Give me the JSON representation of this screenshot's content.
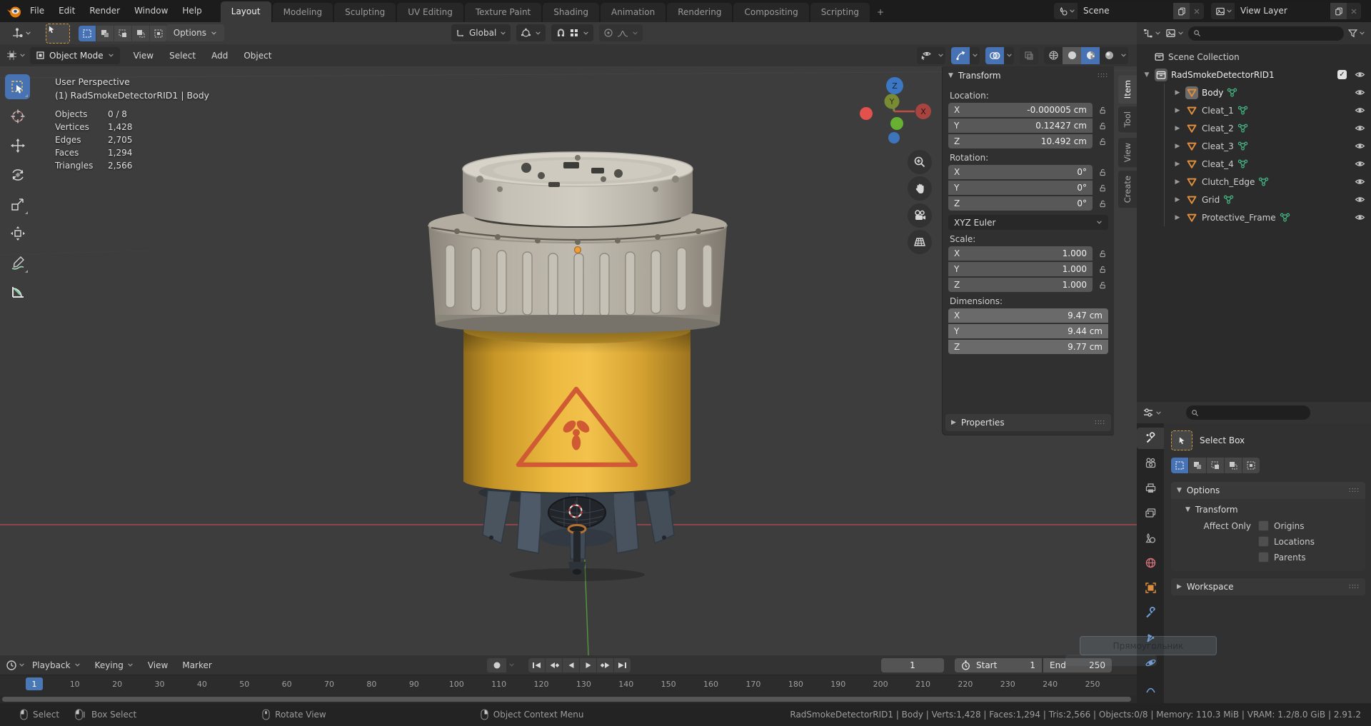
{
  "topbar": {
    "menus": [
      "File",
      "Edit",
      "Render",
      "Window",
      "Help"
    ],
    "tabs": [
      "Layout",
      "Modeling",
      "Sculpting",
      "UV Editing",
      "Texture Paint",
      "Shading",
      "Animation",
      "Rendering",
      "Compositing",
      "Scripting"
    ],
    "new_tab": "+",
    "scene": {
      "label": "Scene"
    },
    "view_layer": {
      "label": "View Layer"
    }
  },
  "tools": {
    "orientation": "Global",
    "options": "Options"
  },
  "viewport": {
    "mode": "Object Mode",
    "menus": [
      "View",
      "Select",
      "Add",
      "Object"
    ],
    "overlay": {
      "view": "User Perspective",
      "object": "(1) RadSmokeDetectorRID1 | Body",
      "stats": [
        {
          "label": "Objects",
          "value": "0 / 8"
        },
        {
          "label": "Vertices",
          "value": "1,428"
        },
        {
          "label": "Edges",
          "value": "2,705"
        },
        {
          "label": "Faces",
          "value": "1,294"
        },
        {
          "label": "Triangles",
          "value": "2,566"
        }
      ]
    },
    "axis_labels": {
      "x": "X",
      "y": "Y",
      "z": "Z"
    },
    "sidebar_tabs": [
      "Item",
      "Tool",
      "View",
      "Create"
    ]
  },
  "npanel": {
    "title": "Transform",
    "location_label": "Location:",
    "rows_loc": [
      {
        "axis": "X",
        "value": "-0.000005 cm"
      },
      {
        "axis": "Y",
        "value": "0.12427 cm"
      },
      {
        "axis": "Z",
        "value": "10.492 cm"
      }
    ],
    "rotation_label": "Rotation:",
    "rows_rot": [
      {
        "axis": "X",
        "value": "0°"
      },
      {
        "axis": "Y",
        "value": "0°"
      },
      {
        "axis": "Z",
        "value": "0°"
      }
    ],
    "euler": "XYZ Euler",
    "scale_label": "Scale:",
    "rows_scale": [
      {
        "axis": "X",
        "value": "1.000"
      },
      {
        "axis": "Y",
        "value": "1.000"
      },
      {
        "axis": "Z",
        "value": "1.000"
      }
    ],
    "dims_label": "Dimensions:",
    "rows_dims": [
      {
        "axis": "X",
        "value": "9.47 cm"
      },
      {
        "axis": "Y",
        "value": "9.44 cm"
      },
      {
        "axis": "Z",
        "value": "9.77 cm"
      }
    ],
    "properties": "Properties"
  },
  "outliner": {
    "root": "Scene Collection",
    "collection": "RadSmokeDetectorRID1",
    "objects": [
      "Body",
      "Cleat_1",
      "Cleat_2",
      "Cleat_3",
      "Cleat_4",
      "Clutch_Edge",
      "Grid",
      "Protective_Frame"
    ]
  },
  "props": {
    "tool": "Select Box",
    "options": "Options",
    "transform": "Transform",
    "affect_only": "Affect Only",
    "checks": [
      "Origins",
      "Locations",
      "Parents"
    ],
    "workspace": "Workspace"
  },
  "timeline": {
    "menus": [
      "Playback",
      "Keying",
      "View",
      "Marker"
    ],
    "playhead": "1",
    "ticks": [
      "10",
      "20",
      "30",
      "40",
      "50",
      "60",
      "70",
      "80",
      "90",
      "100",
      "110",
      "120",
      "130",
      "140",
      "150",
      "160",
      "170",
      "180",
      "190",
      "200",
      "210",
      "220",
      "230",
      "240",
      "250"
    ],
    "frame": "1",
    "start_label": "Start",
    "start_value": "1",
    "end_label": "End",
    "end_value": "250"
  },
  "statusbar": {
    "hints": [
      "Select",
      "Box Select",
      "Rotate View",
      "Object Context Menu"
    ],
    "info": "RadSmokeDetectorRID1 | Body | Verts:1,428 | Faces:1,294 | Tris:2,566 | Objects:0/8 | Memory: 110.3 MiB | VRAM: 1.2/8.0 GiB | 2.91.2"
  },
  "tooltip": {
    "text": "Прямоугольник"
  },
  "colors": {
    "accent": "#4772b3",
    "axis_x": "#b84a55",
    "axis_y": "#56a33e",
    "mesh_icon": "#e08e3c",
    "data_icon": "#44b884",
    "body_yellow": "#e8b33a",
    "warning": "#cf5a33",
    "world_icon": "#d4727e",
    "modifier_icon": "#6f9fd8"
  }
}
